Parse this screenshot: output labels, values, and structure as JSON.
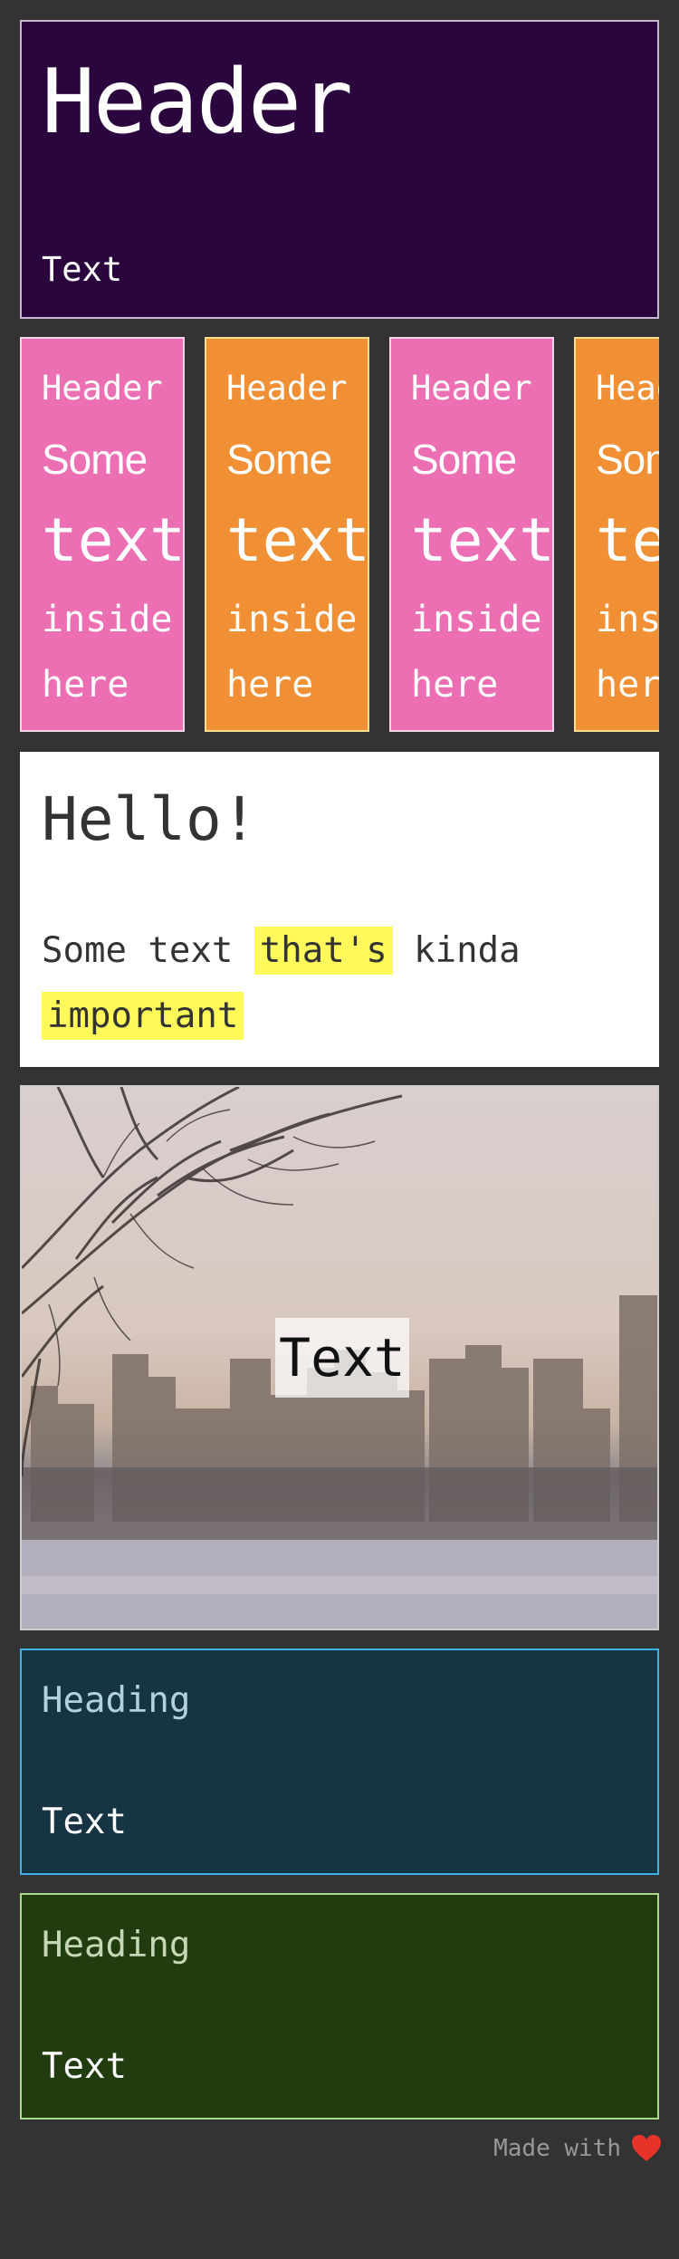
{
  "hero": {
    "title": "Header",
    "text": "Text"
  },
  "cards": [
    {
      "header": "Header",
      "line1": "Some",
      "line2": "text",
      "line3": "inside",
      "line4": "here",
      "color": "#ec6fb3"
    },
    {
      "header": "Header",
      "line1": "Some",
      "line2": "text",
      "line3": "inside",
      "line4": "here",
      "color": "#f08f34"
    },
    {
      "header": "Header",
      "line1": "Some",
      "line2": "text",
      "line3": "inside",
      "line4": "here",
      "color": "#ec6fb3"
    },
    {
      "header": "Header",
      "line1": "Some",
      "line2": "text",
      "line3": "inside",
      "line4": "here",
      "color": "#f08f34"
    }
  ],
  "hello": {
    "title": "Hello!",
    "text_before": "Some text ",
    "highlight1": "that's",
    "text_middle": " kinda ",
    "highlight2": "important",
    "highlight_color": "#fff95a"
  },
  "photo": {
    "caption": "Text",
    "icon": "city-skyline-image"
  },
  "blue_panel": {
    "heading": "Heading",
    "text": "Text",
    "accent": "#3eb3e8"
  },
  "green_panel": {
    "heading": "Heading",
    "text": "Text",
    "accent": "#a8dc8c"
  },
  "footer": {
    "text": "Made with",
    "icon": "heart-icon",
    "heart_color": "#e8332a"
  }
}
